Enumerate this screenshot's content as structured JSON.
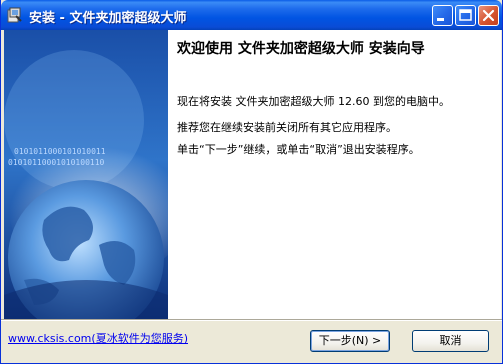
{
  "window": {
    "title": "安装 - 文件夹加密超级大师"
  },
  "main": {
    "welcome_title": "欢迎使用 文件夹加密超级大师 安装向导",
    "para1": "现在将安装 文件夹加密超级大师 12.60 到您的电脑中。",
    "para2": "推荐您在继续安装前关闭所有其它应用程序。",
    "para3": "单击“下一步”继续，或单击“取消”退出安装程序。"
  },
  "sidebar_image": {
    "binary_text_1": "0101011000101010011",
    "binary_text_2": "01010110001010100110"
  },
  "footer": {
    "link": "www.cksis.com(夏冰软件为您服务)",
    "next_label": "下一步(N) >",
    "cancel_label": "取消"
  },
  "colors": {
    "titlebar": "#0054e3",
    "window_bg": "#ece9d8",
    "link": "#0000ee"
  }
}
